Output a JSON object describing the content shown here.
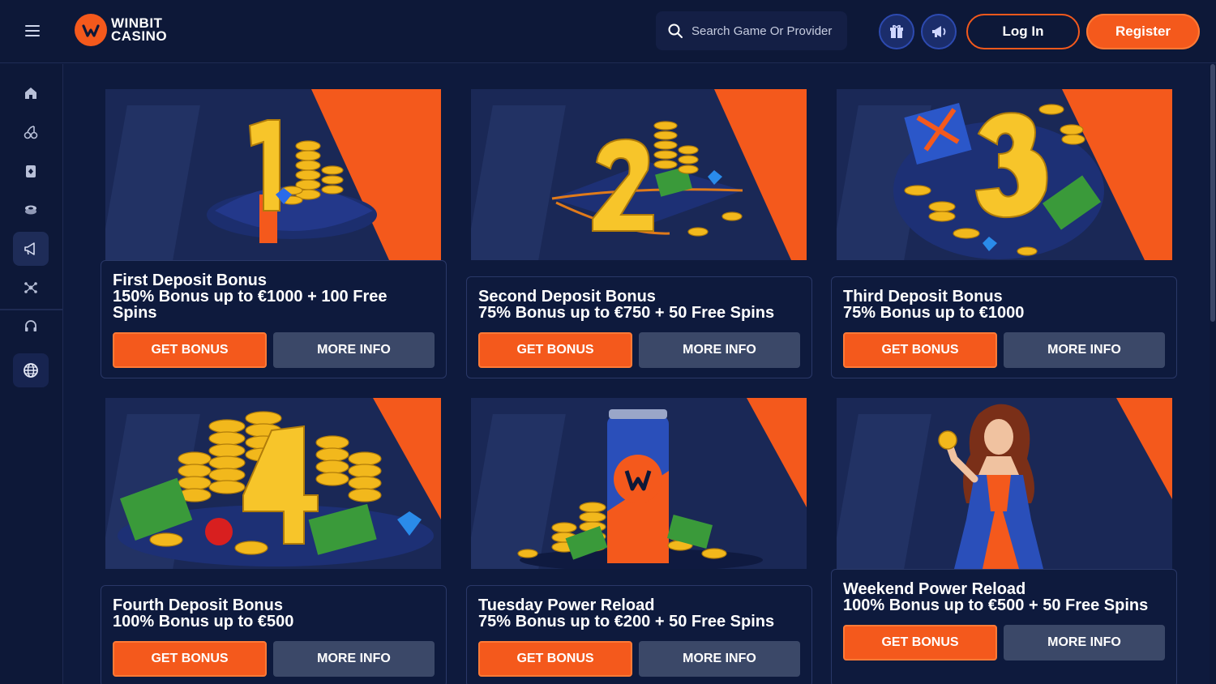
{
  "header": {
    "logo_line1": "WINBIT",
    "logo_line2": "CASINO",
    "search_placeholder": "Search Game Or Provider",
    "login_label": "Log In",
    "register_label": "Register"
  },
  "sidebar": {
    "items": [
      {
        "icon": "home-icon"
      },
      {
        "icon": "cherries-icon"
      },
      {
        "icon": "cards-icon"
      },
      {
        "icon": "poker-chips-icon"
      },
      {
        "icon": "megaphone-icon",
        "active": true
      },
      {
        "icon": "network-icon"
      },
      {
        "icon": "headset-icon"
      },
      {
        "icon": "globe-icon"
      }
    ]
  },
  "colors": {
    "accent": "#f4591c",
    "background": "#0e1a3d",
    "card_image_bg": "#1a2856",
    "secondary_button": "#3b4868"
  },
  "bonuses": [
    {
      "title": "First Deposit Bonus",
      "description": "150% Bonus up to €1000 + 100 Free Spins",
      "art": "1",
      "get_label": "GET BONUS",
      "info_label": "MORE INFO"
    },
    {
      "title": "Second Deposit Bonus",
      "description": "75% Bonus up to €750 + 50 Free Spins",
      "art": "2",
      "get_label": "GET BONUS",
      "info_label": "MORE INFO"
    },
    {
      "title": "Third Deposit Bonus",
      "description": "75% Bonus up to €1000",
      "art": "3",
      "get_label": "GET BONUS",
      "info_label": "MORE INFO"
    },
    {
      "title": "Fourth Deposit Bonus",
      "description": "100% Bonus up to €500",
      "art": "4",
      "get_label": "GET BONUS",
      "info_label": "MORE INFO"
    },
    {
      "title": "Tuesday Power Reload",
      "description": "75% Bonus up to €200 + 50 Free Spins",
      "art": "can",
      "get_label": "GET BONUS",
      "info_label": "MORE INFO"
    },
    {
      "title": "Weekend Power Reload",
      "description": "100% Bonus up to €500 + 50 Free Spins",
      "art": "woman",
      "get_label": "GET BONUS",
      "info_label": "MORE INFO"
    }
  ]
}
